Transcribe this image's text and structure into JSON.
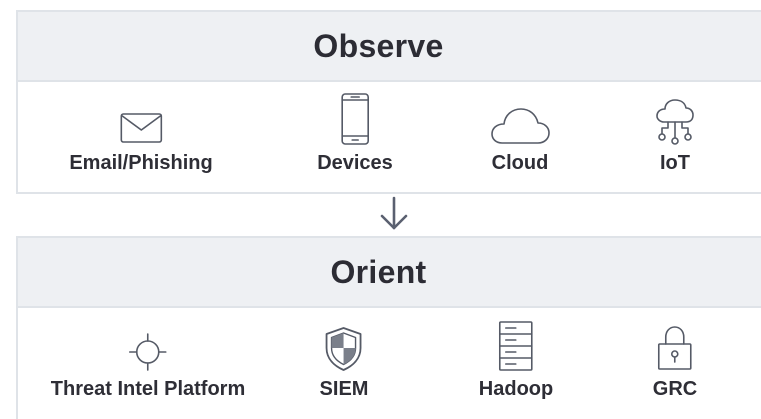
{
  "observe": {
    "title": "Observe",
    "items": [
      {
        "label": "Email/Phishing",
        "icon": "envelope-icon"
      },
      {
        "label": "Devices",
        "icon": "smartphone-icon"
      },
      {
        "label": "Cloud",
        "icon": "cloud-icon"
      },
      {
        "label": "IoT",
        "icon": "cloud-network-icon"
      }
    ]
  },
  "orient": {
    "title": "Orient",
    "items": [
      {
        "label": "Threat Intel Platform",
        "icon": "crosshair-icon"
      },
      {
        "label": "SIEM",
        "icon": "shield-icon"
      },
      {
        "label": "Hadoop",
        "icon": "server-rack-icon"
      },
      {
        "label": "GRC",
        "icon": "padlock-icon"
      }
    ]
  },
  "colors": {
    "panel_border": "#dfe3e8",
    "header_background": "#eef0f3",
    "text": "#2e2e36",
    "icon_stroke": "#555a66"
  }
}
